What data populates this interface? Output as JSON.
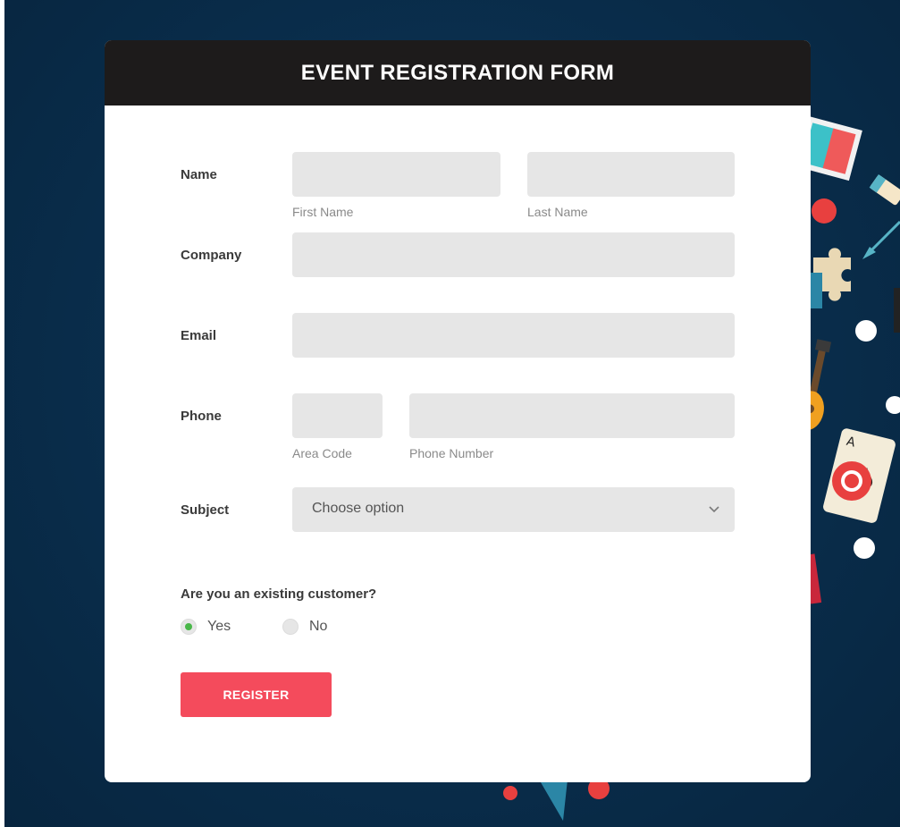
{
  "form": {
    "title": "EVENT REGISTRATION FORM",
    "name": {
      "label": "Name",
      "first_hint": "First Name",
      "last_hint": "Last Name",
      "first_value": "",
      "last_value": ""
    },
    "company": {
      "label": "Company",
      "value": ""
    },
    "email": {
      "label": "Email",
      "value": ""
    },
    "phone": {
      "label": "Phone",
      "area_hint": "Area Code",
      "number_hint": "Phone Number"
    },
    "subject": {
      "label": "Subject",
      "selected": "Choose option"
    },
    "customer": {
      "question": "Are you an existing customer?",
      "options": [
        {
          "label": "Yes",
          "selected": true
        },
        {
          "label": "No",
          "selected": false
        }
      ]
    },
    "submit_label": "REGISTER"
  },
  "colors": {
    "header_bg": "#1d1b1b",
    "field_bg": "#e6e6e6",
    "accent_button": "#f44b5c",
    "radio_selected": "#49b749",
    "page_bg": "#0a2f4e"
  },
  "icons": [
    "chevron-down-icon",
    "radio-selected-icon",
    "radio-unselected-icon"
  ]
}
